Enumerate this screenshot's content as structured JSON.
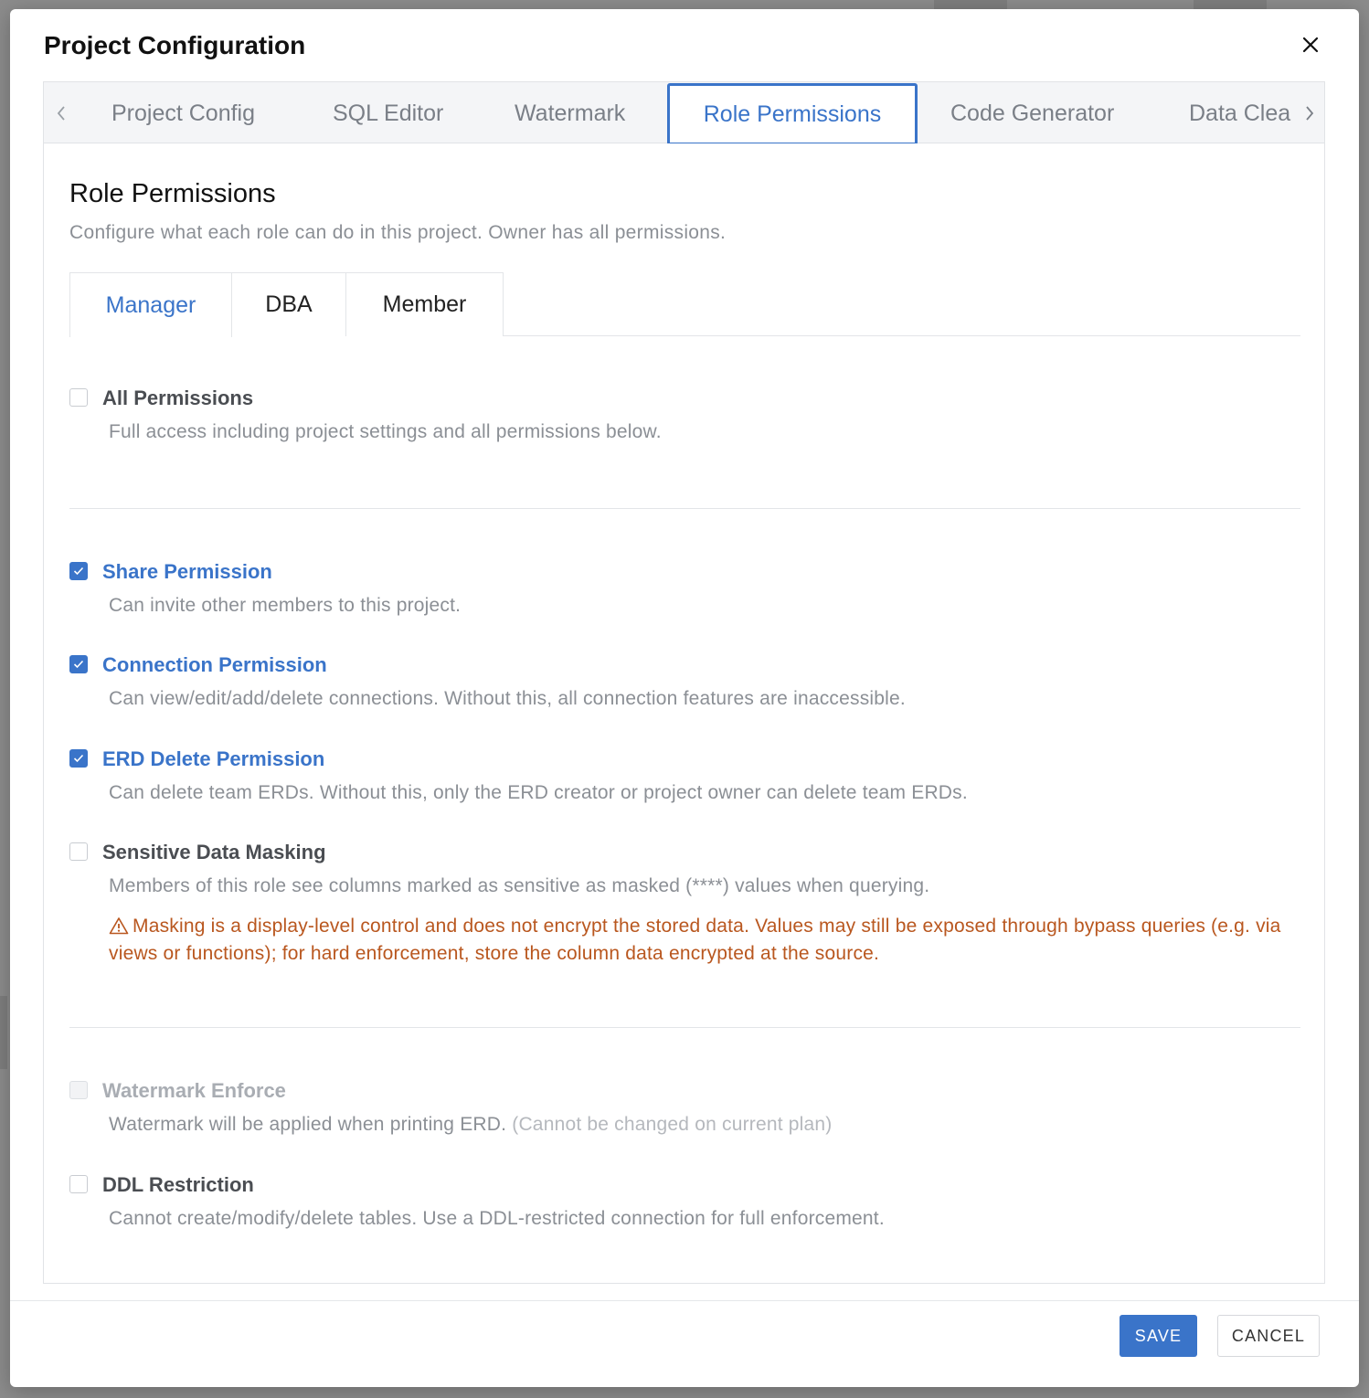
{
  "modal": {
    "title": "Project Configuration"
  },
  "config_tabs": [
    {
      "label": "Project Config"
    },
    {
      "label": "SQL Editor"
    },
    {
      "label": "Watermark"
    },
    {
      "label": "Role Permissions"
    },
    {
      "label": "Code Generator"
    },
    {
      "label": "Data Clea"
    }
  ],
  "active_config_tab": "Role Permissions",
  "section": {
    "title": "Role Permissions",
    "description": "Configure what each role can do in this project. Owner has all permissions."
  },
  "role_tabs": [
    {
      "label": "Manager"
    },
    {
      "label": "DBA"
    },
    {
      "label": "Member"
    }
  ],
  "active_role_tab": "Manager",
  "permissions": {
    "all": {
      "label": "All Permissions",
      "description": "Full access including project settings and all permissions below.",
      "checked": false
    },
    "share": {
      "label": "Share Permission",
      "description": "Can invite other members to this project.",
      "checked": true
    },
    "connection": {
      "label": "Connection Permission",
      "description": "Can view/edit/add/delete connections. Without this, all connection features are inaccessible.",
      "checked": true
    },
    "erd_delete": {
      "label": "ERD Delete Permission",
      "description": "Can delete team ERDs. Without this, only the ERD creator or project owner can delete team ERDs.",
      "checked": true
    },
    "masking": {
      "label": "Sensitive Data Masking",
      "description": "Members of this role see columns marked as sensitive as masked (****) values when querying.",
      "warning": "Masking is a display-level control and does not encrypt the stored data. Values may still be exposed through bypass queries (e.g. via views or functions); for hard enforcement, store the column data encrypted at the source.",
      "checked": false
    },
    "watermark": {
      "label": "Watermark Enforce",
      "description": "Watermark will be applied when printing ERD.",
      "note": "(Cannot be changed on current plan)",
      "checked": false,
      "disabled": true
    },
    "ddl": {
      "label": "DDL Restriction",
      "description": "Cannot create/modify/delete tables. Use a DDL-restricted connection for full enforcement.",
      "checked": false
    }
  },
  "footer": {
    "save_label": "SAVE",
    "cancel_label": "CANCEL"
  },
  "colors": {
    "accent": "#3a74c9",
    "warning": "#b9571f",
    "muted_text": "#8b8f95"
  }
}
